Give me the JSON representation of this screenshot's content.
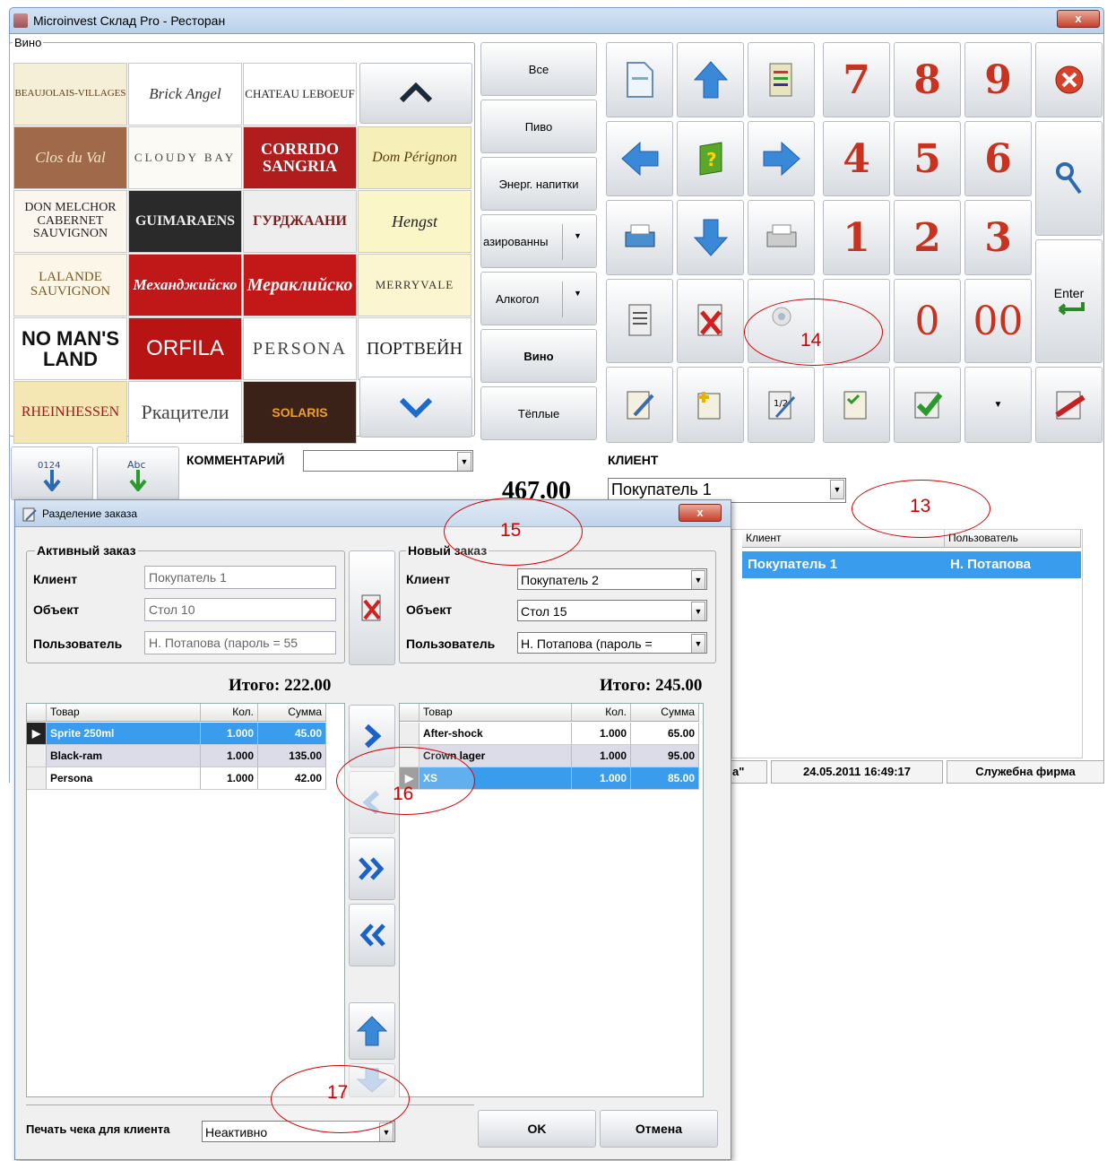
{
  "window": {
    "title": "Microinvest Склад Pro - Ресторан",
    "close": "x"
  },
  "wine_group": {
    "legend": "Вино",
    "tiles": [
      "BEAUJOLAIS-VILLAGES",
      "Brick Angel",
      "CHATEAU LEBOEUF",
      "Clos du Val",
      "CLOUDY BAY",
      "CORRIDO SANGRIA",
      "Dom Pérignon",
      "DON MELCHOR CABERNET SAUVIGNON",
      "GUIMARAENS",
      "ГУРДЖААНИ",
      "Hengst",
      "LALANDE SAUVIGNON",
      "Механджийско",
      "Мерaклийско",
      "MERRYVALE",
      "NO MAN'S LAND",
      "ORFILA",
      "PERSONA",
      "ПОРТВЕЙН",
      "RHEINHESSEN",
      "Ркацители",
      "SOLARIS"
    ]
  },
  "categories": [
    "Все",
    "Пиво",
    "Энерг. напитки",
    "азированны",
    "Алкогол",
    "Вино",
    "Тёплые"
  ],
  "numpad": [
    "7",
    "8",
    "9",
    "4",
    "5",
    "6",
    "1",
    "2",
    "3",
    "0",
    "00"
  ],
  "enter_label": "Enter",
  "comment_label": "КОММЕНТАРИЙ",
  "total_partial": "467.00",
  "client_label": "КЛИЕНТ",
  "client_value": "Покупатель 1",
  "orders_table": {
    "headers": [
      "Клиент",
      "Пользователь"
    ],
    "row": [
      "Покупатель 1",
      "Н. Потапова"
    ]
  },
  "status_bar": {
    "left": "а\"",
    "datetime": "24.05.2011 16:49:17",
    "firm": "Служебна фирма"
  },
  "callouts": {
    "c13": "13",
    "c14": "14",
    "c15": "15",
    "c16": "16",
    "c17": "17"
  },
  "dialog": {
    "title": "Разделение заказа",
    "active": {
      "legend": "Активный заказ",
      "client_label": "Клиент",
      "client": "Покупатель 1",
      "object_label": "Объект",
      "object": "Стол 10",
      "user_label": "Пользователь",
      "user": "Н. Потапова  (пароль = 55",
      "total": "Итого: 222.00"
    },
    "new": {
      "legend": "Новый заказ",
      "client_label": "Клиент",
      "client": "Покупатель 2",
      "object_label": "Объект",
      "object": "Стол 15",
      "user_label": "Пользователь",
      "user": "Н. Потапова  (пароль =",
      "total": "Итого: 245.00"
    },
    "columns": [
      "Товар",
      "Кол.",
      "Сумма"
    ],
    "left_rows": [
      {
        "item": "Sprite 250ml",
        "qty": "1.000",
        "sum": "45.00"
      },
      {
        "item": "Black-ram",
        "qty": "1.000",
        "sum": "135.00"
      },
      {
        "item": "Persona",
        "qty": "1.000",
        "sum": "42.00"
      }
    ],
    "right_rows": [
      {
        "item": "After-shock",
        "qty": "1.000",
        "sum": "65.00"
      },
      {
        "item": "Crown lager",
        "qty": "1.000",
        "sum": "95.00"
      },
      {
        "item": "XS",
        "qty": "1.000",
        "sum": "85.00"
      }
    ],
    "print_label": "Печать чека для клиента",
    "print_value": "Неактивно",
    "ok": "OK",
    "cancel": "Отмена"
  }
}
